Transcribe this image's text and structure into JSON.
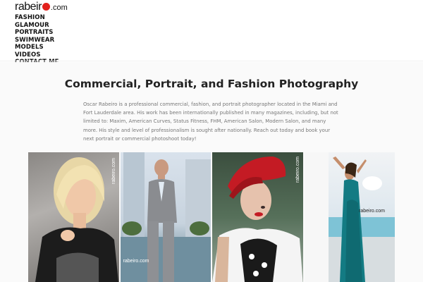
{
  "logo": {
    "word": "rabeir",
    "domain": ".com"
  },
  "nav": {
    "items": [
      {
        "label": "FASHION"
      },
      {
        "label": "GLAMOUR"
      },
      {
        "label": "PORTRAITS"
      },
      {
        "label": "SWIMWEAR"
      },
      {
        "label": "MODELS"
      },
      {
        "label": "VIDEOS"
      },
      {
        "label": "CONTACT ME"
      }
    ]
  },
  "main": {
    "title": "Commercial, Portrait, and Fashion Photography",
    "intro": "Oscar Rabeiro is a professional commercial, fashion, and portrait photographer located in the Miami and Fort Lauderdale area. His work has been internationally published in many magazines, including, but not limited to: Maxim, American Curves, Status Fitness, FHM, American Salon, Modern Salon, and many more. His style and level of professionalism is sought after nationally. Reach out today and book your next portrait or commercial photoshoot today!"
  },
  "gallery": {
    "watermark": "rabeiro.com",
    "items": [
      {
        "subject": "blonde-woman-portrait"
      },
      {
        "subject": "man-in-grey-suit"
      },
      {
        "subject": "woman-red-hat"
      },
      {
        "subject": "woman-teal-dress"
      }
    ]
  },
  "colors": {
    "logo_dot": "#e2211c",
    "background": "#fafafa"
  }
}
